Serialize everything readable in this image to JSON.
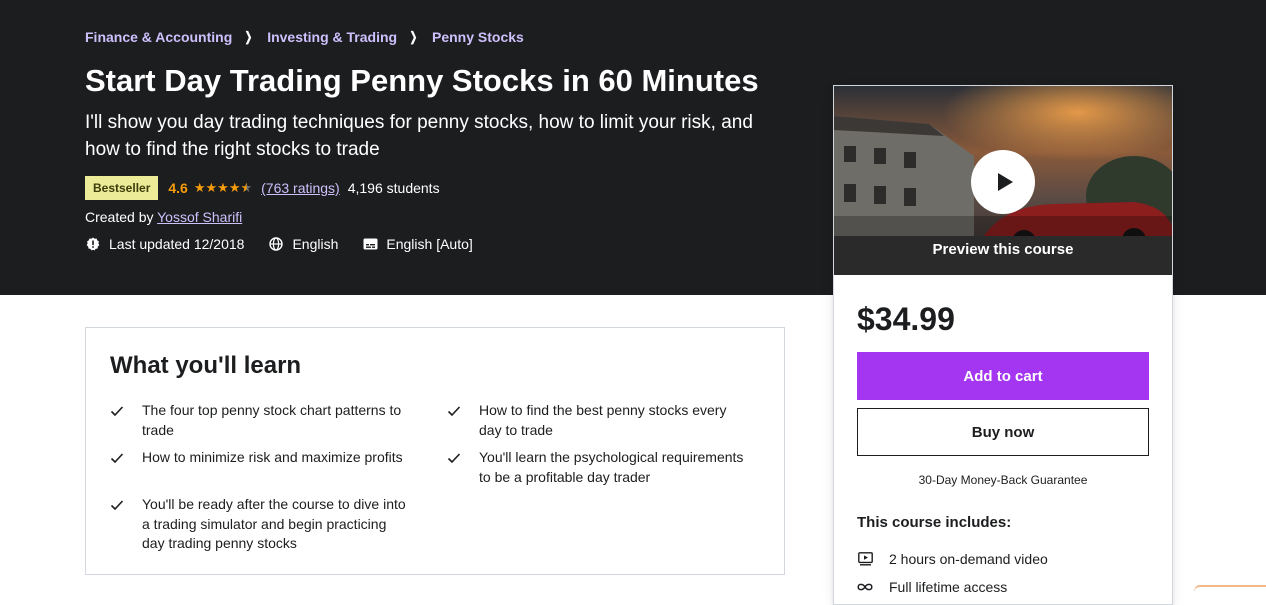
{
  "breadcrumb": [
    "Finance & Accounting",
    "Investing & Trading",
    "Penny Stocks"
  ],
  "course": {
    "title": "Start Day Trading Penny Stocks in 60 Minutes",
    "subtitle": "I'll show you day trading techniques for penny stocks, how to limit your risk, and how to find the right stocks to trade",
    "badge": "Bestseller",
    "rating": "4.6",
    "rating_stars": 4.6,
    "ratings_count": "(763 ratings)",
    "students": "4,196 students",
    "created_by_label": "Created by",
    "author": "Yossof Sharifi",
    "last_updated": "Last updated 12/2018",
    "language": "English",
    "captions": "English [Auto]"
  },
  "sidebar": {
    "preview_label": "Preview this course",
    "price": "$34.99",
    "add_to_cart": "Add to cart",
    "buy_now": "Buy now",
    "guarantee": "30-Day Money-Back Guarantee",
    "includes_title": "This course includes:",
    "includes": [
      {
        "icon": "video-icon",
        "label": "2 hours on-demand video"
      },
      {
        "icon": "infinity-icon",
        "label": "Full lifetime access"
      }
    ]
  },
  "learn": {
    "title": "What you'll learn",
    "items": [
      "The four top penny stock chart patterns to trade",
      "How to find the best penny stocks every day to trade",
      "How to minimize risk and maximize profits",
      "You'll learn the psychological requirements to be a profitable day trader",
      "You'll be ready after the course to dive into a trading simulator and begin practicing day trading penny stocks"
    ]
  },
  "colors": {
    "hero_bg": "#1c1d1f",
    "link_purple": "#cec0fc",
    "star_orange": "#f69c08",
    "badge_bg": "#eceb98",
    "cta_purple": "#a435f0"
  }
}
